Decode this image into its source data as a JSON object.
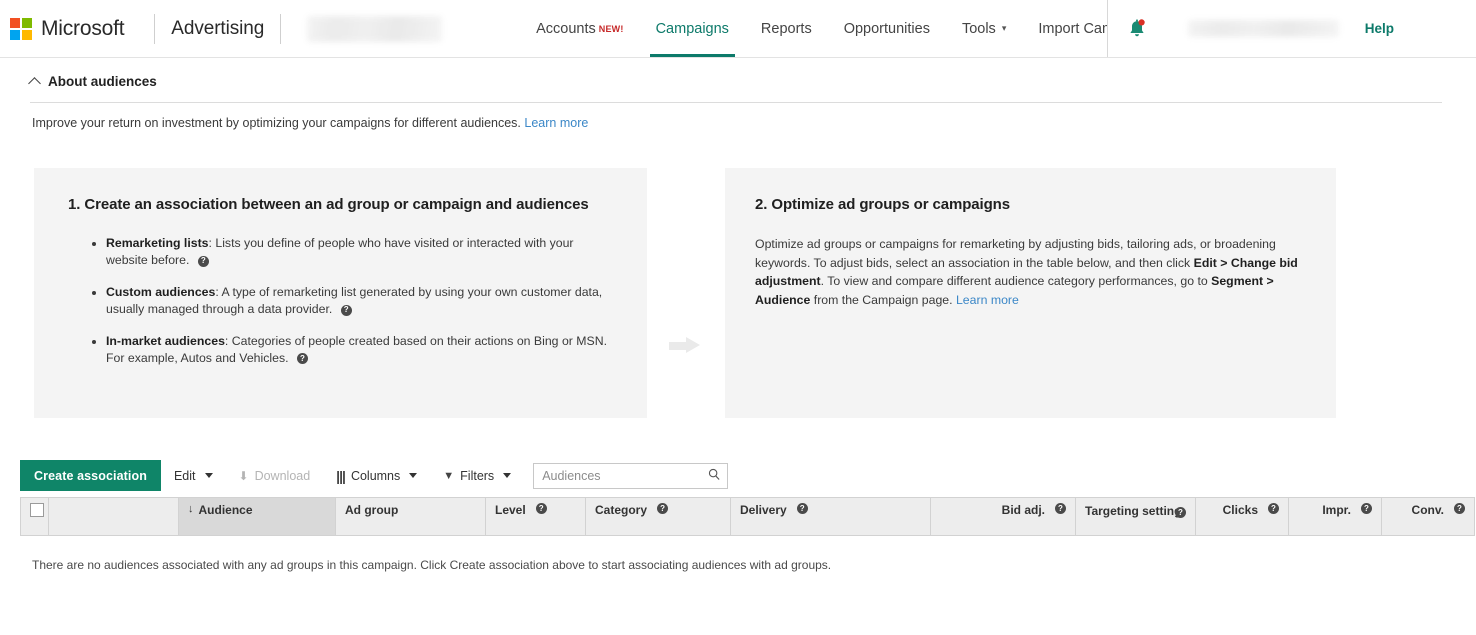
{
  "header": {
    "brand": "Microsoft",
    "product": "Advertising",
    "account_placeholder_redacted": true,
    "nav": [
      {
        "label": "Accounts",
        "badge": "NEW!",
        "active": false,
        "caret": false
      },
      {
        "label": "Campaigns",
        "badge": "",
        "active": true,
        "caret": false
      },
      {
        "label": "Reports",
        "badge": "",
        "active": false,
        "caret": false
      },
      {
        "label": "Opportunities",
        "badge": "",
        "active": false,
        "caret": false
      },
      {
        "label": "Tools",
        "badge": "",
        "active": false,
        "caret": true
      },
      {
        "label": "Import Cam",
        "badge": "",
        "active": false,
        "caret": false
      }
    ],
    "notifications_icon": "bell-icon",
    "help_label": "Help"
  },
  "about": {
    "title": "About audiences",
    "collapse_icon": "chevron-up-icon",
    "intro": "Improve your return on investment by optimizing your campaigns for different audiences.",
    "learn_more": "Learn more"
  },
  "panels": {
    "arrow_icon": "arrow-right-icon",
    "left": {
      "heading": "1. Create an association between an ad group or campaign and audiences",
      "bullets": [
        {
          "term": "Remarketing lists",
          "text": ": Lists you define of people who have visited or interacted with your website before."
        },
        {
          "term": "Custom audiences",
          "text": ": A type of remarketing list generated by using your own customer data, usually managed through a data provider."
        },
        {
          "term": "In-market audiences",
          "text": ": Categories of people created based on their actions on Bing or MSN. For example, Autos and Vehicles."
        }
      ],
      "help_icon": "question-mark-icon"
    },
    "right": {
      "heading": "2. Optimize ad groups or campaigns",
      "body_1": "Optimize ad groups or campaigns for remarketing by adjusting bids, tailoring ads, or broadening keywords. To adjust bids, select an association in the table below, and then click ",
      "bold_1": "Edit > Change bid adjustment",
      "body_2": ". To view and compare different audience category performances, go to ",
      "bold_2": "Segment > Audience",
      "body_3": " from the Campaign page. ",
      "learn_more": "Learn more"
    }
  },
  "toolbar": {
    "create_association": "Create association",
    "edit": "Edit",
    "download": "Download",
    "download_icon": "download-icon",
    "columns": "Columns",
    "columns_icon": "columns-icon",
    "filters": "Filters",
    "filters_icon": "filter-icon",
    "search_placeholder": "Audiences",
    "search_value": "",
    "search_icon": "search-icon"
  },
  "table": {
    "select_all_checkbox": "select-all-checkbox",
    "sort_icon": "sort-descending-arrow",
    "columns": [
      {
        "label": "",
        "help": false,
        "sorted": false,
        "numeric": false
      },
      {
        "label": "",
        "help": false,
        "sorted": false,
        "numeric": false
      },
      {
        "label": "Audience",
        "help": false,
        "sorted": true,
        "numeric": false
      },
      {
        "label": "Ad group",
        "help": false,
        "sorted": false,
        "numeric": false
      },
      {
        "label": "Level",
        "help": true,
        "sorted": false,
        "numeric": false
      },
      {
        "label": "Category",
        "help": true,
        "sorted": false,
        "numeric": false
      },
      {
        "label": "Delivery",
        "help": true,
        "sorted": false,
        "numeric": false
      },
      {
        "label": "Bid adj.",
        "help": true,
        "sorted": false,
        "numeric": true
      },
      {
        "label": "Targeting setting",
        "help": true,
        "sorted": false,
        "numeric": false
      },
      {
        "label": "Clicks",
        "help": true,
        "sorted": false,
        "numeric": true
      },
      {
        "label": "Impr.",
        "help": true,
        "sorted": false,
        "numeric": true
      },
      {
        "label": "Conv.",
        "help": true,
        "sorted": false,
        "numeric": true
      }
    ],
    "rows": [],
    "empty_message": "There are no audiences associated with any ad groups in this campaign. Click Create association above to start associating audiences with ad groups."
  },
  "colors": {
    "brand_teal": "#0d7a6a",
    "button_teal": "#0f8568",
    "link_blue": "#3b87c7",
    "badge_red": "#c62828",
    "panel_bg": "#f4f4f4",
    "header_bg": "#ededed",
    "ms_red": "#f25022",
    "ms_green": "#7fba00",
    "ms_blue": "#00a4ef",
    "ms_yellow": "#ffb900"
  }
}
